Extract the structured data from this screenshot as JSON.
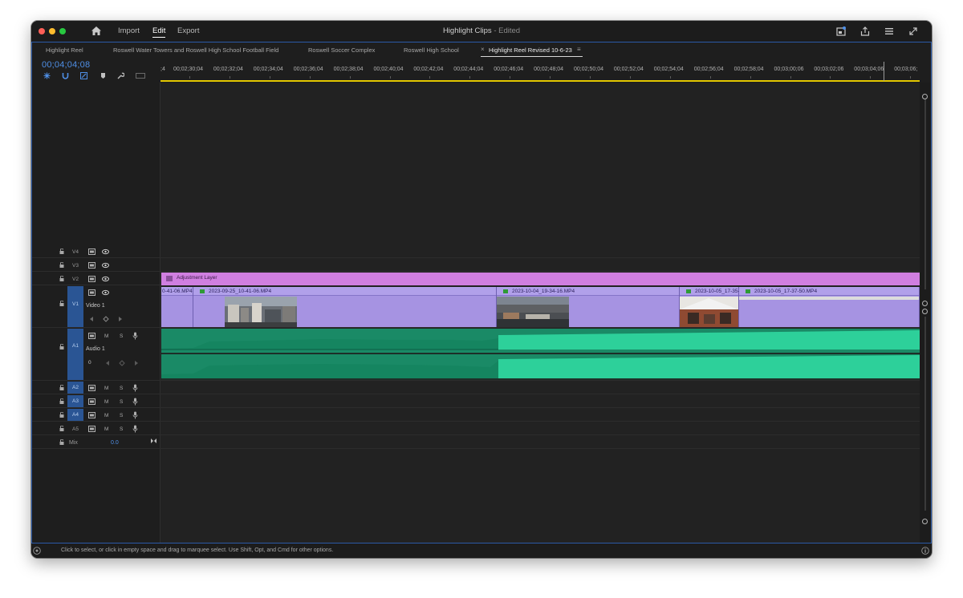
{
  "window": {
    "title": "Highlight Clips",
    "title_suffix": "- Edited"
  },
  "menu": {
    "import": "Import",
    "edit": "Edit",
    "export": "Export"
  },
  "sequence_tabs": [
    {
      "label": "Highlight Reel"
    },
    {
      "label": "Roswell Water Towers and Roswell High School Football Field"
    },
    {
      "label": "Roswell Soccer Complex"
    },
    {
      "label": "Roswell High School"
    },
    {
      "label": "Highlight Reel Revised 10-6-23",
      "active": true
    }
  ],
  "tab_close": "×",
  "tab_menu": "≡",
  "timecode": "00;04;04;08",
  "ruler": {
    "lead": ";4",
    "ticks": [
      "00;02;30;04",
      "00;02;32;04",
      "00;02;34;04",
      "00;02;36;04",
      "00;02;38;04",
      "00;02;40;04",
      "00;02;42;04",
      "00;02;44;04",
      "00;02;46;04",
      "00;02;48;04",
      "00;02;50;04",
      "00;02;52;04",
      "00;02;54;04",
      "00;02;56;04",
      "00;02;58;04",
      "00;03;00;06",
      "00;03;02;06",
      "00;03;04;06",
      "00;03;06;"
    ]
  },
  "tracks": {
    "v4": "V4",
    "v3": "V3",
    "v2": "V2",
    "v1": "V1",
    "v1_name": "Video 1",
    "a1": "A1",
    "a1_name": "Audio 1",
    "a2": "A2",
    "a3": "A3",
    "a4": "A4",
    "a5": "A5",
    "m": "M",
    "s": "S",
    "mix": "Mix",
    "mix_value": "0.0",
    "volume": "0"
  },
  "clips": {
    "adjustment_layer": "Adjustment Layer",
    "video": [
      {
        "name": "0-41-06.MP4"
      },
      {
        "name": "2023-09-25_10-41-06.MP4"
      },
      {
        "name": "2023-10-04_19-34-16.MP4"
      },
      {
        "name": "2023-10-05_17-35-"
      },
      {
        "name": "2023-10-05_17-37-50.MP4"
      }
    ]
  },
  "status_text": "Click to select, or click in empty space and drag to marquee select. Use Shift, Opt, and Cmd for other options.",
  "colors": {
    "accent_blue": "#4f8fe6",
    "adjustment_layer": "#d07fe0",
    "video_clip": "#a693e2",
    "audio_clip": "#1f9d74",
    "ruler_work_area": "#e3c800"
  }
}
